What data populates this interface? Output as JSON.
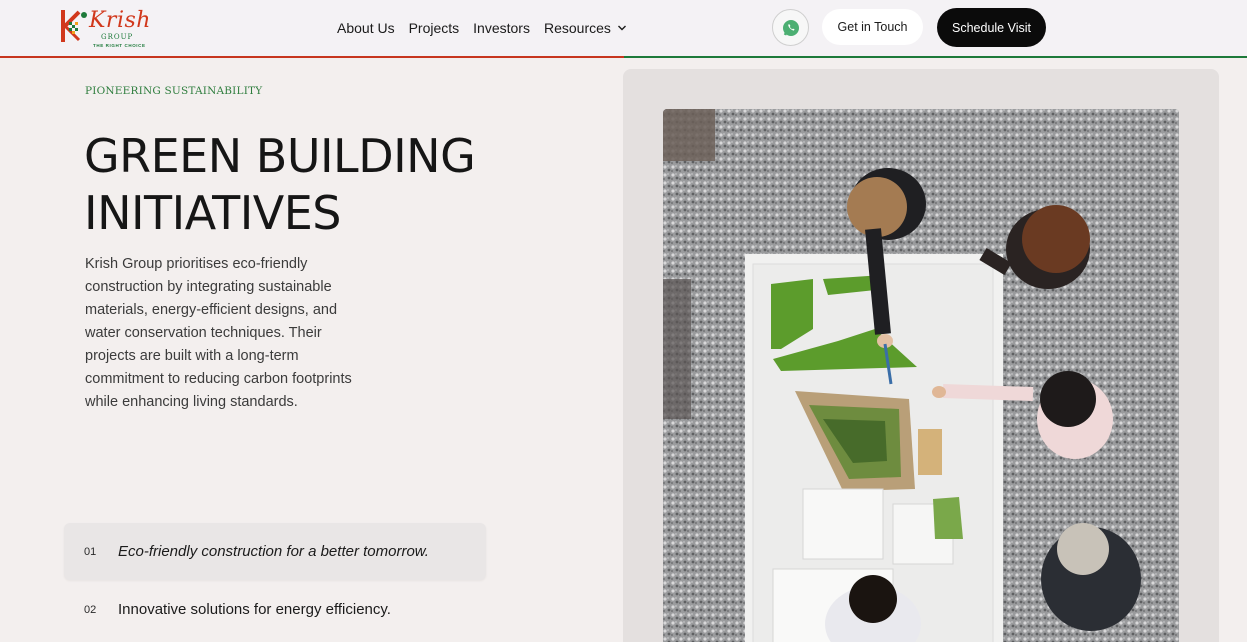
{
  "header": {
    "logo": {
      "name": "Krish",
      "sub": "GROUP",
      "tagline": "THE RIGHT CHOICE"
    },
    "nav": [
      {
        "label": "About Us"
      },
      {
        "label": "Projects"
      },
      {
        "label": "Investors"
      },
      {
        "label": "Resources",
        "has_dropdown": true
      }
    ],
    "whatsapp_icon": "whatsapp-icon",
    "get_in_touch_label": "Get in Touch",
    "schedule_visit_label": "Schedule Visit"
  },
  "hero": {
    "eyebrow": "PIONEERING SUSTAINABILITY",
    "title_line1": "GREEN BUILDING",
    "title_line2": "INITIATIVES",
    "description": "Krish Group prioritises eco-friendly construction by integrating sustainable materials, energy-efficient designs, and water conservation techniques. Their projects are built with a long-term commitment to reducing carbon footprints while enhancing living standards."
  },
  "features": [
    {
      "num": "01",
      "text": "Eco-friendly construction for a better tomorrow.",
      "active": true
    },
    {
      "num": "02",
      "text": "Innovative solutions for energy efficiency.",
      "active": false
    }
  ],
  "colors": {
    "brand_red": "#d1381c",
    "brand_green": "#1d7a3a",
    "accent_black": "#0b0b0b",
    "background": "#f3efee"
  }
}
